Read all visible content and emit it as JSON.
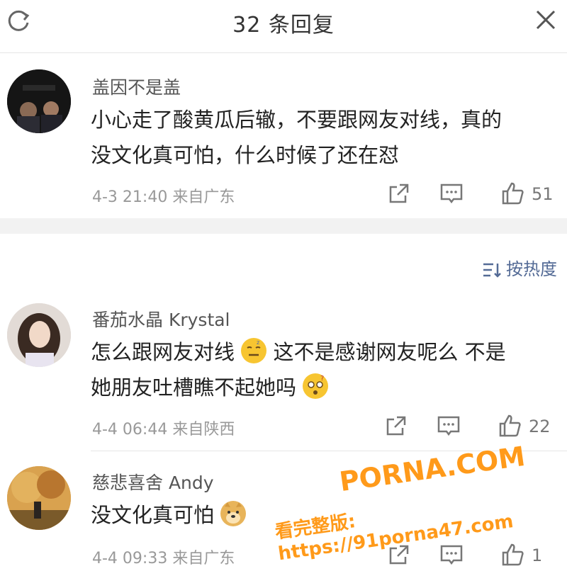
{
  "header": {
    "title": "32 条回复"
  },
  "comments": [
    {
      "username": "盖因不是盖",
      "text": "小心走了酸黄瓜后辙，不要跟网友对线，真的没文化真可怕，什么时候了还在怼",
      "line1": "小心走了酸黄瓜后辙，不要跟网友对线，真的",
      "line2": "没文化真可怕，什么时候了还在怼",
      "time": "4-3 21:40",
      "location": "来自广东",
      "likes": "51"
    },
    {
      "username": "番茄水晶 Krystal",
      "line1_a": "怎么跟网友对线",
      "line1_b": "这不是感谢网友呢么 不是",
      "line2": "她朋友吐槽瞧不起她吗",
      "time": "4-4 06:44",
      "location": "来自陕西",
      "likes": "22"
    },
    {
      "username": "慈悲喜舍 Andy",
      "line1": "没文化真可怕",
      "time": "4-4 09:33",
      "location": "来自广东",
      "likes": "1"
    }
  ],
  "sort": {
    "label": "按热度"
  },
  "watermark": {
    "line1": "PORNA.COM",
    "line2": "看完整版: https://91porna47.com"
  },
  "colors": {
    "link": "#546b96",
    "watermark": "#ff9a1a"
  }
}
